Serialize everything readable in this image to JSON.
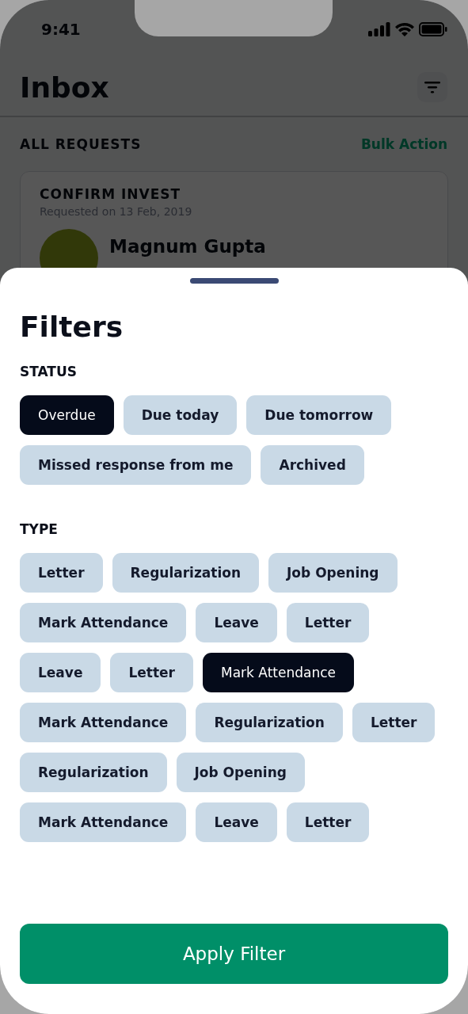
{
  "status_bar": {
    "time": "9:41"
  },
  "header": {
    "title": "Inbox"
  },
  "section": {
    "title": "ALL REQUESTS",
    "action": "Bulk Action"
  },
  "request_card": {
    "title": "CONFIRM INVEST",
    "subtitle": "Requested on 13 Feb, 2019",
    "name": "Magnum Gupta"
  },
  "filters": {
    "title": "Filters",
    "groups": [
      {
        "title": "STATUS",
        "chips": [
          {
            "label": "Overdue",
            "selected": true
          },
          {
            "label": "Due today",
            "selected": false
          },
          {
            "label": "Due tomorrow",
            "selected": false
          },
          {
            "label": "Missed response from me",
            "selected": false
          },
          {
            "label": "Archived",
            "selected": false
          }
        ]
      },
      {
        "title": "TYPE",
        "chips": [
          {
            "label": "Letter",
            "selected": false
          },
          {
            "label": "Regularization",
            "selected": false
          },
          {
            "label": "Job Opening",
            "selected": false
          },
          {
            "label": "Mark Attendance",
            "selected": false
          },
          {
            "label": "Leave",
            "selected": false
          },
          {
            "label": "Letter",
            "selected": false
          },
          {
            "label": "Leave",
            "selected": false
          },
          {
            "label": "Letter",
            "selected": false
          },
          {
            "label": "Mark Attendance",
            "selected": true
          },
          {
            "label": "Mark Attendance",
            "selected": false
          },
          {
            "label": "Regularization",
            "selected": false
          },
          {
            "label": "Letter",
            "selected": false
          },
          {
            "label": "Regularization",
            "selected": false
          },
          {
            "label": "Job Opening",
            "selected": false
          },
          {
            "label": "Mark Attendance",
            "selected": false
          },
          {
            "label": "Leave",
            "selected": false
          },
          {
            "label": "Letter",
            "selected": false
          }
        ]
      }
    ],
    "apply_button": "Apply Filter"
  }
}
